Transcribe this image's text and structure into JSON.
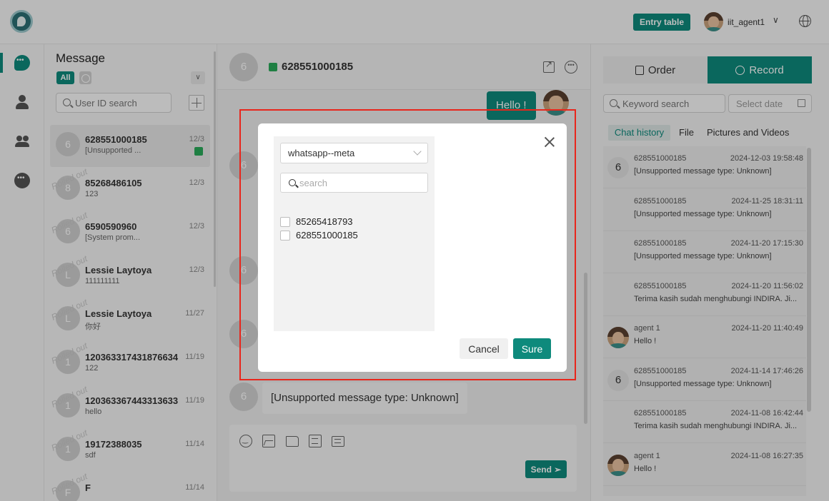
{
  "header": {
    "entry_button": "Entry table",
    "user_name": "iit_agent1"
  },
  "sidebar": {
    "items": [
      {
        "icon": "chat-icon",
        "active": true
      },
      {
        "icon": "user-icon"
      },
      {
        "icon": "group-icon"
      },
      {
        "icon": "more-icon"
      }
    ]
  },
  "message_list": {
    "title": "Message",
    "filter_all": "All",
    "search_placeholder": "User ID search",
    "rolled_out_label": "Rolled out",
    "conversations": [
      {
        "avatar": "6",
        "name": "628551000185",
        "preview": "[Unsupported ...",
        "date": "12/3"
      },
      {
        "avatar": "8",
        "name": "85268486105",
        "preview": "123",
        "date": "12/3"
      },
      {
        "avatar": "6",
        "name": "6590590960",
        "preview": "[System prom...",
        "date": "12/3"
      },
      {
        "avatar": "L",
        "name": "Lessie Laytoya",
        "preview": "111111111",
        "date": "12/3"
      },
      {
        "avatar": "L",
        "name": "Lessie Laytoya",
        "preview": "你好",
        "date": "11/27"
      },
      {
        "avatar": "1",
        "name": "120363317431876634",
        "preview": "122",
        "date": "11/19"
      },
      {
        "avatar": "1",
        "name": "120363367443313633",
        "preview": "hello",
        "date": "11/19"
      },
      {
        "avatar": "1",
        "name": "19172388035",
        "preview": "sdf",
        "date": "11/14"
      },
      {
        "avatar": "F",
        "name": "F",
        "preview": "",
        "date": "11/14"
      }
    ]
  },
  "chat": {
    "avatar": "6",
    "title": "628551000185",
    "outgoing_message": "Hello !",
    "background_avatars": [
      "6",
      "6",
      "6",
      "6"
    ],
    "incoming_message": "[Unsupported message type: Unknown]",
    "send_label": "Send"
  },
  "right_panel": {
    "order_label": "Order",
    "record_label": "Record",
    "keyword_placeholder": "Keyword search",
    "date_placeholder": "Select date",
    "tabs": [
      "Chat history",
      "File",
      "Pictures and Videos"
    ],
    "history": [
      {
        "avatar": "6",
        "agent": false,
        "name": "628551000185",
        "time": "2024-12-03 19:58:48",
        "preview": "[Unsupported message type: Unknown]"
      },
      {
        "avatar": "",
        "agent": false,
        "name": "628551000185",
        "time": "2024-11-25 18:31:11",
        "preview": "[Unsupported message type: Unknown]"
      },
      {
        "avatar": "",
        "agent": false,
        "name": "628551000185",
        "time": "2024-11-20 17:15:30",
        "preview": "[Unsupported message type: Unknown]"
      },
      {
        "avatar": "",
        "agent": false,
        "name": "628551000185",
        "time": "2024-11-20 11:56:02",
        "preview": "Terima kasih sudah menghubungi INDIRA. Ji..."
      },
      {
        "avatar": "",
        "agent": true,
        "name": "agent 1",
        "time": "2024-11-20 11:40:49",
        "preview": "Hello !"
      },
      {
        "avatar": "6",
        "agent": false,
        "name": "628551000185",
        "time": "2024-11-14 17:46:26",
        "preview": "[Unsupported message type: Unknown]"
      },
      {
        "avatar": "",
        "agent": false,
        "name": "628551000185",
        "time": "2024-11-08 16:42:44",
        "preview": "Terima kasih sudah menghubungi INDIRA. Ji..."
      },
      {
        "avatar": "",
        "agent": true,
        "name": "agent 1",
        "time": "2024-11-08 16:27:35",
        "preview": "Hello !"
      }
    ]
  },
  "modal": {
    "account_select": "whatsapp--meta",
    "search_placeholder": "search",
    "options": [
      "85265418793",
      "628551000185"
    ],
    "cancel_label": "Cancel",
    "sure_label": "Sure"
  },
  "colors": {
    "accent": "#0e8a7c",
    "whatsapp": "#2aaa5a",
    "highlight_frame": "#e8261c"
  }
}
